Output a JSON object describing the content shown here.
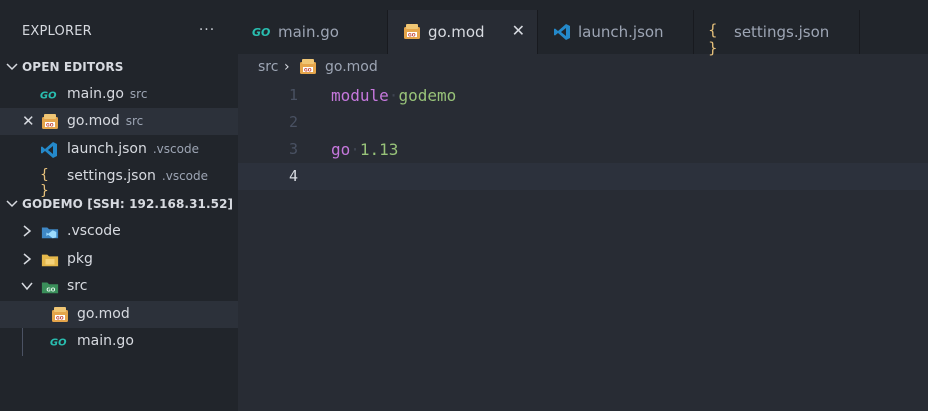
{
  "sidebar": {
    "title": "EXPLORER",
    "more": "···",
    "open_editors": {
      "header": "OPEN EDITORS",
      "items": [
        {
          "name": "main.go",
          "desc": "src",
          "icon": "go-file-icon"
        },
        {
          "name": "go.mod",
          "desc": "src",
          "icon": "go-mod-icon",
          "close": "✕"
        },
        {
          "name": "launch.json",
          "desc": ".vscode",
          "icon": "vscode-icon"
        },
        {
          "name": "settings.json",
          "desc": ".vscode",
          "icon": "json-braces-icon"
        }
      ]
    },
    "workspace": {
      "header": "GODEMO [SSH: 192.168.31.52]",
      "items": [
        {
          "name": ".vscode",
          "icon": "vscode-folder-icon",
          "expanded": false
        },
        {
          "name": "pkg",
          "icon": "folder-icon",
          "expanded": false
        },
        {
          "name": "src",
          "icon": "go-folder-icon",
          "expanded": true
        },
        {
          "name": "go.mod",
          "icon": "go-mod-icon"
        },
        {
          "name": "main.go",
          "icon": "go-file-icon"
        }
      ]
    }
  },
  "tabs": [
    {
      "label": "main.go",
      "icon": "go-file-icon",
      "active": false
    },
    {
      "label": "go.mod",
      "icon": "go-mod-icon",
      "active": true,
      "close": "✕"
    },
    {
      "label": "launch.json",
      "icon": "vscode-icon",
      "active": false
    },
    {
      "label": "settings.json",
      "icon": "json-braces-icon",
      "active": false
    }
  ],
  "breadcrumb": {
    "folder": "src",
    "separator": "›",
    "file": "go.mod"
  },
  "editor": {
    "lines": [
      {
        "number": "1",
        "tokens": [
          {
            "t": "module",
            "c": "kw"
          },
          {
            "t": "·",
            "c": "ws"
          },
          {
            "t": "godemo",
            "c": "str"
          }
        ]
      },
      {
        "number": "2",
        "tokens": []
      },
      {
        "number": "3",
        "tokens": [
          {
            "t": "go",
            "c": "kw"
          },
          {
            "t": "·",
            "c": "ws"
          },
          {
            "t": "1.13",
            "c": "num"
          }
        ]
      },
      {
        "number": "4",
        "tokens": [],
        "current": true
      }
    ]
  },
  "colors": {
    "background": "#282c34",
    "sidebar": "#21252b",
    "keyword": "#c678dd",
    "string": "#98c379",
    "go_blue": "#29beb0",
    "vscode_blue": "#2489ca",
    "json_yellow": "#e5c07b"
  }
}
